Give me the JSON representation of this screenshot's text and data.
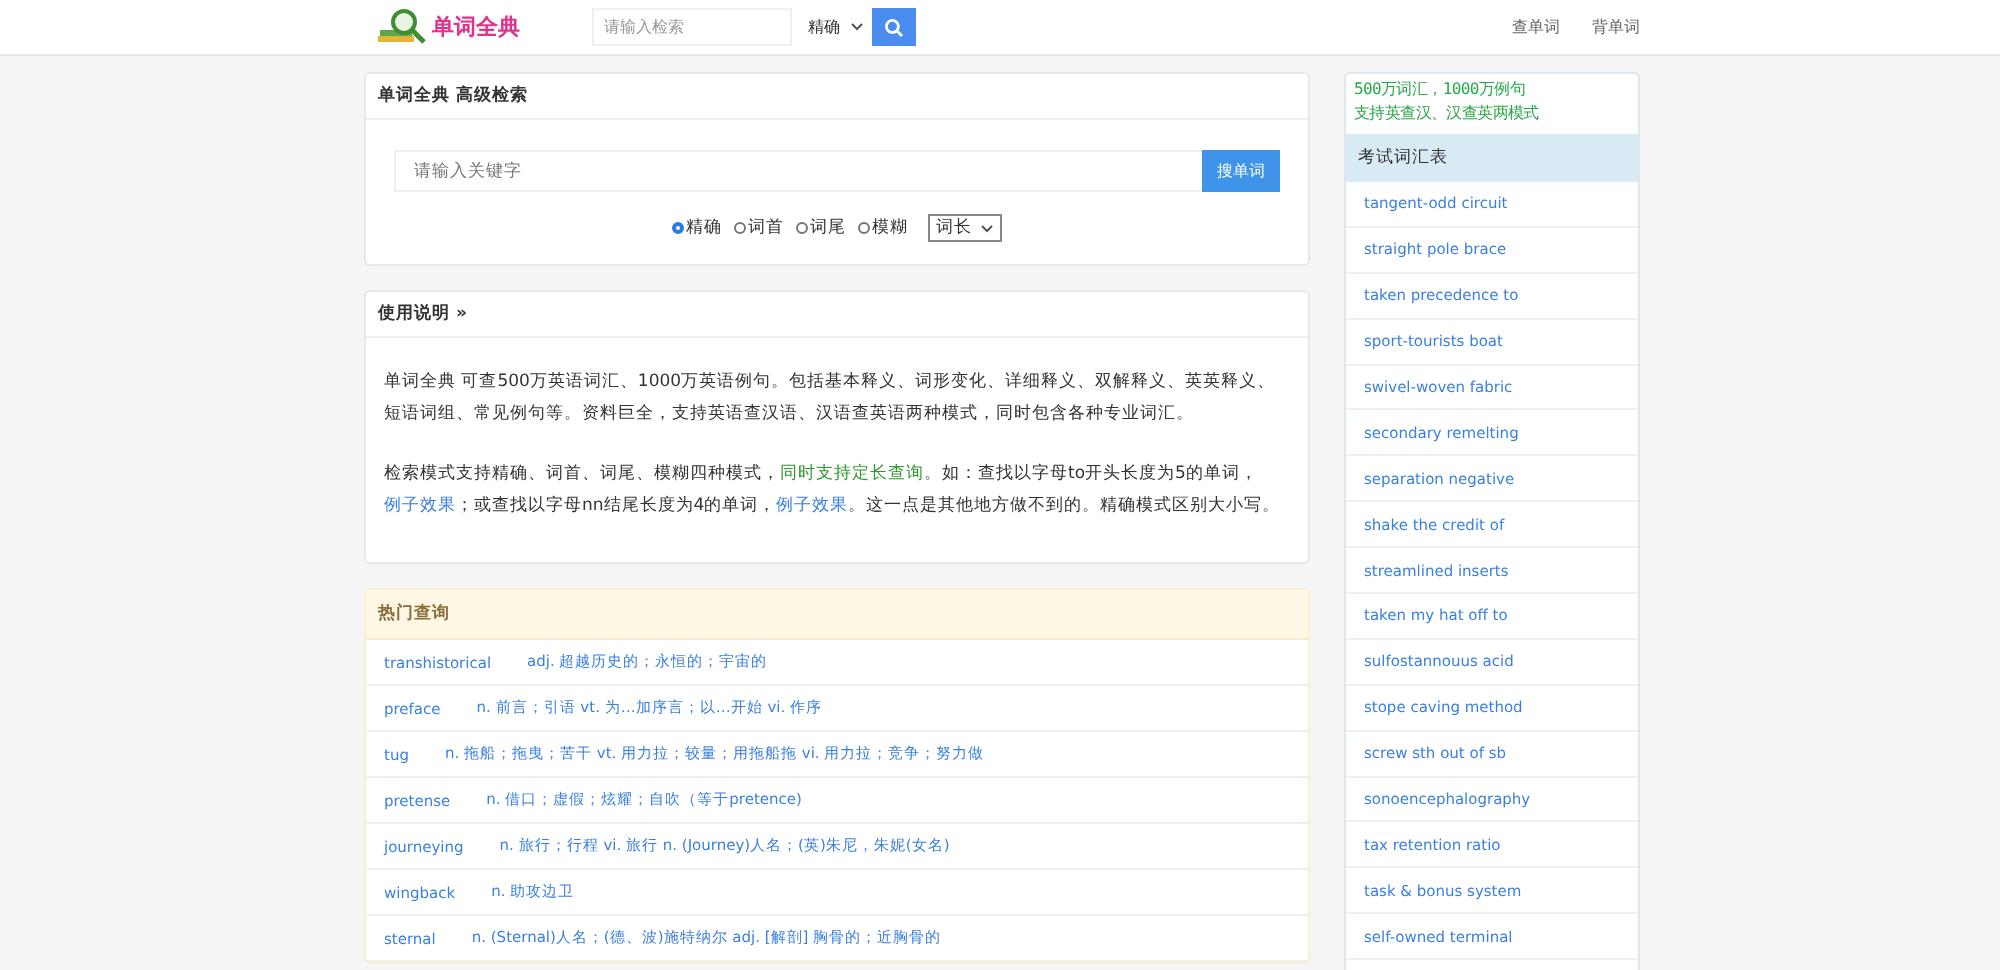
{
  "header": {
    "logo_text": "单词全典",
    "search": {
      "placeholder": "请输入检索"
    },
    "mode_select": {
      "value": "精确"
    },
    "nav_links": [
      "查单词",
      "背单词"
    ]
  },
  "advanced_search": {
    "title": "单词全典 高级检索",
    "keyword": {
      "placeholder": "请输入关键字"
    },
    "submit": "搜单词",
    "modes": [
      {
        "label": "精确",
        "selected": true
      },
      {
        "label": "词首",
        "selected": false
      },
      {
        "label": "词尾",
        "selected": false
      },
      {
        "label": "模糊",
        "selected": false
      }
    ],
    "length_select": {
      "value": "词长"
    }
  },
  "usage": {
    "title": "使用说明 »",
    "paragraphs": [
      [
        {
          "kind": "text",
          "text": "单词全典 可查500万英语词汇、1000万英语例句。包括基本释义、词形变化、详细释义、双解释义、英英释义、短语词组、常见例句等。资料巨全，支持英语查汉语、汉语查英语两种模式，同时包含各种专业词汇。"
        }
      ],
      [
        {
          "kind": "text",
          "text": "检索模式支持精确、词首、词尾、模糊四种模式，"
        },
        {
          "kind": "highlight",
          "text": "同时支持定长查询"
        },
        {
          "kind": "text",
          "text": "。如：查找以字母to开头长度为5的单词，"
        },
        {
          "kind": "link",
          "text": "例子效果"
        },
        {
          "kind": "text",
          "text": "；或查找以字母nn结尾长度为4的单词，"
        },
        {
          "kind": "link",
          "text": "例子效果"
        },
        {
          "kind": "text",
          "text": "。这一点是其他地方做不到的。精确模式区别大小写。"
        }
      ]
    ]
  },
  "hot_queries": {
    "title": "热门查询",
    "rows": [
      {
        "word": "transhistorical",
        "meaning": "adj. 超越历史的；永恒的；宇宙的"
      },
      {
        "word": "preface",
        "meaning": "n. 前言；引语 vt. 为…加序言；以…开始 vi. 作序"
      },
      {
        "word": "tug",
        "meaning": "n. 拖船；拖曳；苦干 vt. 用力拉；较量；用拖船拖 vi. 用力拉；竞争；努力做"
      },
      {
        "word": "pretense",
        "meaning": "n. 借口；虚假；炫耀；自吹（等于pretence)"
      },
      {
        "word": "journeying",
        "meaning": "n. 旅行；行程 vi. 旅行 n. (Journey)人名；(英)朱尼，朱妮(女名)"
      },
      {
        "word": "wingback",
        "meaning": "n. 助攻边卫"
      },
      {
        "word": "sternal",
        "meaning": "n. (Sternal)人名；(德、波)施特纳尔 adj. [解剖] 胸骨的；近胸骨的"
      }
    ]
  },
  "sidebar": {
    "slogan": [
      "500万词汇，1000万例句",
      "支持英查汉、汉查英两模式"
    ],
    "title": "考试词汇表",
    "items": [
      "tangent-odd circuit",
      "straight pole brace",
      "taken precedence to",
      "sport-tourists boat",
      "swivel-woven fabric",
      "secondary remelting",
      "separation negative",
      "shake the credit of",
      "streamlined inserts",
      "taken my hat off to",
      "sulfostannouus acid",
      "stope caving method",
      "screw sth out of sb",
      "sonoencephalography",
      "tax retention ratio",
      "task & bonus system",
      "self-owned terminal"
    ]
  }
}
